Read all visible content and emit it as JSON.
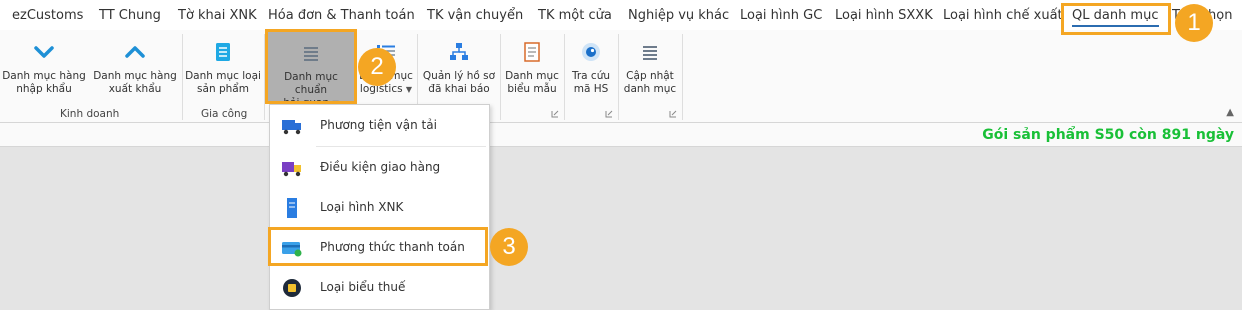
{
  "tabs": [
    {
      "label": "ezCustoms"
    },
    {
      "label": "TT Chung"
    },
    {
      "label": "Tờ khai XNK"
    },
    {
      "label": "Hóa đơn & Thanh toán"
    },
    {
      "label": "TK vận chuyển"
    },
    {
      "label": "TK một cửa"
    },
    {
      "label": "Nghiệp vụ khác"
    },
    {
      "label": "Loại hình GC"
    },
    {
      "label": "Loại hình SXXK"
    },
    {
      "label": "Loại hình chế xuất"
    },
    {
      "label": "QL danh mục"
    },
    {
      "label": "Tr",
      "suffix": "ợ giúp"
    }
  ],
  "tabs_tail": "họn",
  "ribbon": {
    "buttons": [
      {
        "label": "Danh mục hàng\nnhập khẩu",
        "icon": "chevron-down-icon"
      },
      {
        "label": "Danh mục hàng\nxuất khẩu",
        "icon": "chevron-up-icon"
      },
      {
        "label": "Danh mục loại\nsản phẩm",
        "icon": "list-icon"
      },
      {
        "label": "Danh mục chuẩn\nhải quan",
        "icon": "lines-icon"
      },
      {
        "label": "logistics",
        "label_top": "Danh mục",
        "icon": "list-detail-icon"
      },
      {
        "label": "Quản lý hồ sơ\nđã khai báo",
        "icon": "hierarchy-icon"
      },
      {
        "label": "Danh mục\nbiểu mẫu",
        "icon": "document-icon"
      },
      {
        "label": "Tra cứu\nmã HS",
        "icon": "eye-icon"
      },
      {
        "label": "Cập nhật\ndanh mục",
        "icon": "menu-icon"
      }
    ],
    "groups": [
      {
        "label": "Kinh doanh"
      },
      {
        "label": "Gia công"
      }
    ]
  },
  "status": {
    "text": "Gói sản phẩm S50 còn 891 ngày"
  },
  "dropdown": {
    "items": [
      {
        "label": "Phương tiện vận tải",
        "icon": "truck-icon"
      },
      {
        "label": "Điều kiện giao hàng",
        "icon": "delivery-truck-icon"
      },
      {
        "label": "Loại hình XNK",
        "icon": "server-icon"
      },
      {
        "label": "Phương thức thanh toán",
        "icon": "card-icon"
      },
      {
        "label": "Loại biểu thuế",
        "icon": "tax-icon"
      }
    ]
  },
  "annotations": [
    {
      "number": "1"
    },
    {
      "number": "2"
    },
    {
      "number": "3"
    }
  ],
  "colors": {
    "accent": "#f4a623",
    "status_green": "#19c037",
    "tab_underline": "#2b6cb0"
  }
}
